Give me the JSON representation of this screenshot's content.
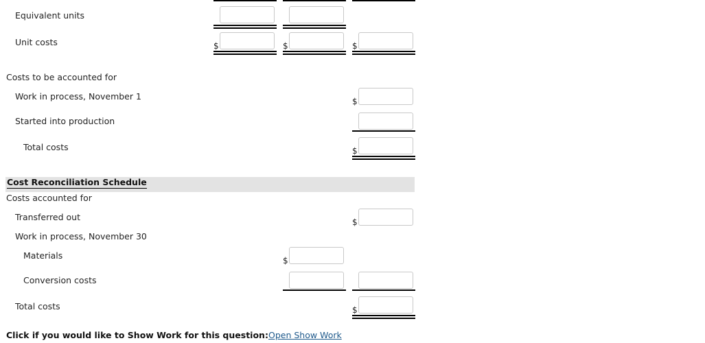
{
  "rows": {
    "equivalent_units": "Equivalent units",
    "unit_costs": "Unit costs",
    "costs_to_be_accounted_for": "Costs to be accounted for",
    "wip_nov1": "Work in process, November 1",
    "started_into_production": "Started into production",
    "total_costs_1": "Total costs"
  },
  "reconciliation": {
    "title": "Cost Reconciliation Schedule",
    "costs_accounted_for": "Costs accounted for",
    "transferred_out": "Transferred out",
    "wip_nov30": "Work in process, November 30",
    "materials": "Materials",
    "conversion_costs": "Conversion costs",
    "total_costs": "Total costs"
  },
  "currency_symbol": "$",
  "inputs": {
    "eu_col1": "",
    "eu_col2": "",
    "uc_col1": "",
    "uc_col2": "",
    "uc_col3": "",
    "wip_nov1": "",
    "started": "",
    "total_costs_1": "",
    "transferred_out": "",
    "materials": "",
    "conversion_col2": "",
    "conversion_col3": "",
    "total_costs_2": ""
  },
  "footer": {
    "prompt": "Click if you would like to Show Work for this question:",
    "link": "Open Show Work"
  }
}
